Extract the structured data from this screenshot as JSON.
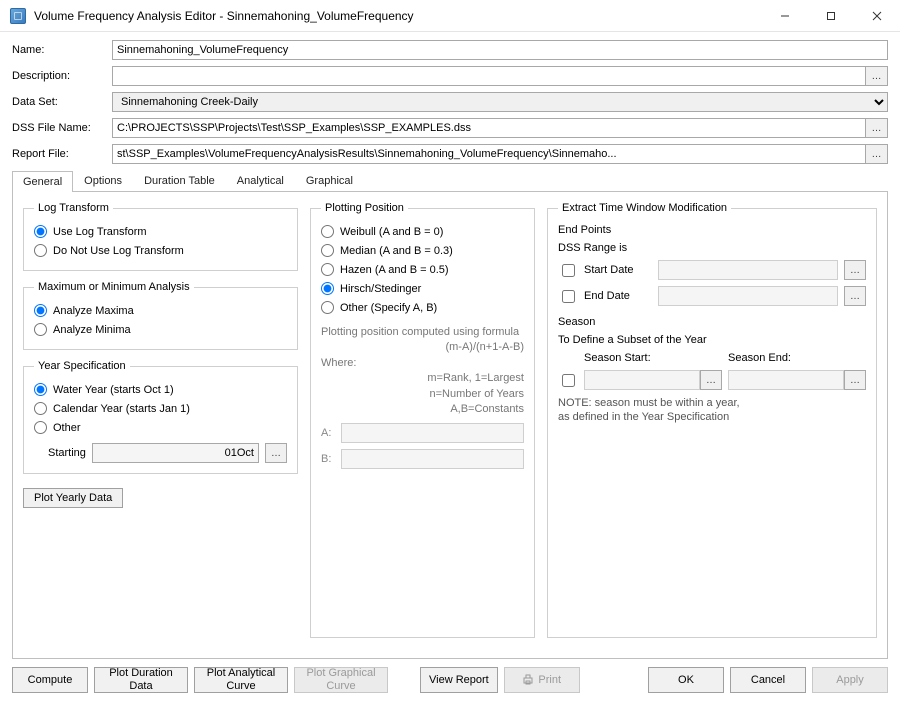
{
  "window": {
    "title": "Volume Frequency Analysis Editor - Sinnemahoning_VolumeFrequency"
  },
  "header": {
    "name_label": "Name:",
    "name_value": "Sinnemahoning_VolumeFrequency",
    "description_label": "Description:",
    "description_value": "",
    "dataset_label": "Data Set:",
    "dataset_value": "Sinnemahoning Creek-Daily",
    "dssfile_label": "DSS File Name:",
    "dssfile_value": "C:\\PROJECTS\\SSP\\Projects\\Test\\SSP_Examples\\SSP_EXAMPLES.dss",
    "reportfile_label": "Report File:",
    "reportfile_value": "st\\SSP_Examples\\VolumeFrequencyAnalysisResults\\Sinnemahoning_VolumeFrequency\\Sinnemaho..."
  },
  "tabs": [
    "General",
    "Options",
    "Duration Table",
    "Analytical",
    "Graphical"
  ],
  "general": {
    "log_transform": {
      "legend": "Log Transform",
      "use": "Use Log Transform",
      "not_use": "Do Not Use Log Transform"
    },
    "maxmin": {
      "legend": "Maximum or Minimum Analysis",
      "maxima": "Analyze Maxima",
      "minima": "Analyze Minima"
    },
    "yearspec": {
      "legend": "Year Specification",
      "water": "Water Year (starts Oct 1)",
      "calendar": "Calendar Year (starts Jan 1)",
      "other": "Other",
      "starting_label": "Starting",
      "starting_value": "01Oct"
    },
    "plot_yearly_btn": "Plot Yearly Data",
    "plotting": {
      "legend": "Plotting Position",
      "weibull": "Weibull (A and B = 0)",
      "median": "Median (A and B = 0.3)",
      "hazen": "Hazen (A and B = 0.5)",
      "hirsch": "Hirsch/Stedinger",
      "other": "Other (Specify A, B)",
      "desc_line1": "Plotting position computed using formula",
      "desc_formula": "(m-A)/(n+1-A-B)",
      "where": "Where:",
      "m_line": "m=Rank, 1=Largest",
      "n_line": "n=Number of Years",
      "ab_line": "A,B=Constants",
      "a_label": "A:",
      "b_label": "B:"
    },
    "timewin": {
      "legend": "Extract Time Window Modification",
      "endpoints": "End Points",
      "dssrange": "DSS Range is",
      "startdate": "Start Date",
      "enddate": "End Date",
      "season": "Season",
      "subset": "To Define a Subset of the Year",
      "season_start": "Season Start:",
      "season_end": "Season End:",
      "note1": "NOTE: season must be within a year,",
      "note2": "as defined in the Year Specification"
    }
  },
  "bottom": {
    "compute": "Compute",
    "plot_duration": "Plot Duration\nData",
    "plot_analytical": "Plot Analytical\nCurve",
    "plot_graphical": "Plot Graphical\nCurve",
    "view_report": "View Report",
    "print": "Print",
    "ok": "OK",
    "cancel": "Cancel",
    "apply": "Apply"
  }
}
